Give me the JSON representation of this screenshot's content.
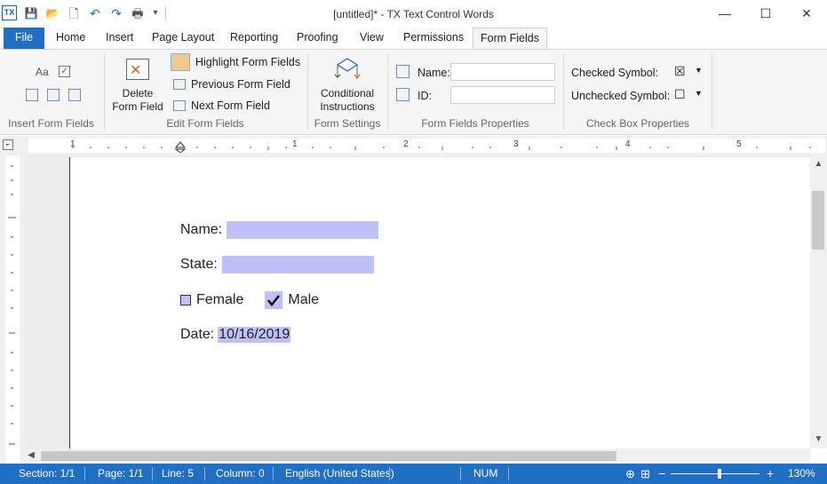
{
  "window": {
    "title": "[untitled]* - TX Text Control Words",
    "logo_text": "TX",
    "minimize": "—",
    "maximize": "☐",
    "close": "✕"
  },
  "qat": {
    "save": "💾",
    "open": "📂",
    "new": "🗋",
    "undo": "↶",
    "redo": "↷",
    "print": "🖶",
    "more": "▾"
  },
  "tabs": [
    "File",
    "Home",
    "Insert",
    "Page Layout",
    "Reporting",
    "Proofing",
    "View",
    "Permissions",
    "Form Fields"
  ],
  "ribbon": {
    "insert_form_fields": {
      "label": "Insert Form Fields"
    },
    "edit_form_fields": {
      "label": "Edit Form Fields",
      "delete_line1": "Delete",
      "delete_line2": "Form Field",
      "highlight": "Highlight Form Fields",
      "previous": "Previous Form Field",
      "next": "Next Form Field"
    },
    "form_settings": {
      "label": "Form Settings",
      "conditional_line1": "Conditional",
      "conditional_line2": "Instructions"
    },
    "form_fields_properties": {
      "label": "Form Fields Properties",
      "name_label": "Name:",
      "name_value": "",
      "id_label": "ID:",
      "id_value": ""
    },
    "check_box_properties": {
      "label": "Check Box Properties",
      "checked_label": "Checked Symbol:",
      "checked_symbol": "☒",
      "unchecked_label": "Unchecked Symbol:",
      "unchecked_symbol": "☐"
    }
  },
  "ruler": {
    "numbers": [
      "1",
      "1",
      "2",
      "3",
      "4",
      "5"
    ]
  },
  "document": {
    "name_label": "Name:",
    "state_label": "State:",
    "female_label": "Female",
    "male_label": "Male",
    "date_label": "Date:",
    "date_value": "10/16/2019"
  },
  "status": {
    "section": "Section: 1/1",
    "page": "Page: 1/1",
    "line": "Line: 5",
    "column": "Column: 0",
    "language": "English (United States)",
    "num": "NUM",
    "zoom": "130%",
    "zoom_minus": "−",
    "zoom_plus": "+"
  },
  "colors": {
    "accent": "#1f6fc5",
    "form_field_highlight": "#bfc0f8"
  }
}
